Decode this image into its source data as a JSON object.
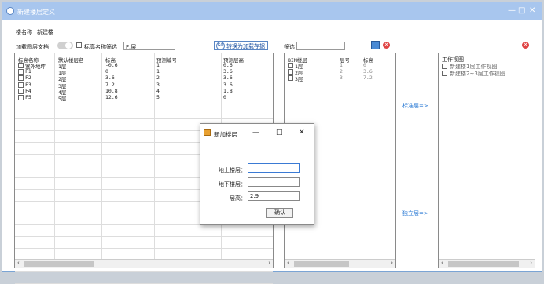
{
  "window": {
    "title": "新建楼层定义",
    "min": "—",
    "max": "□",
    "close": "✕"
  },
  "top": {
    "name_label": "楼名称",
    "name_value": "新建楼",
    "load_label": "加载图层文档",
    "filter_name_label": "标高名称筛选",
    "filter_name_value": "F,层",
    "convert_btn": "转换为加载存据",
    "filter_label": "筛选",
    "filter_value": ""
  },
  "left_table": {
    "headers": [
      "标高名称",
      "默认楼层名",
      "标高",
      "预测编号",
      "预测层高"
    ],
    "rows": [
      [
        "室外地坪",
        "1层",
        "-0.6",
        "1",
        "0.6"
      ],
      [
        "F1",
        "1层",
        "0",
        "1",
        "3.6"
      ],
      [
        "F2",
        "2层",
        "3.6",
        "2",
        "3.6"
      ],
      [
        "F3",
        "3层",
        "7.2",
        "3",
        "3.6"
      ],
      [
        "F4",
        "4层",
        "10.8",
        "4",
        "1.8"
      ],
      [
        "F5",
        "5层",
        "12.6",
        "5",
        "0"
      ]
    ]
  },
  "mid_table": {
    "headers": [
      "BIM楼层",
      "层号",
      "标高"
    ],
    "rows": [
      [
        "1层",
        "1",
        "0"
      ],
      [
        "2层",
        "2",
        "3.6"
      ],
      [
        "3层",
        "3",
        "7.2"
      ]
    ]
  },
  "links": {
    "standard": "标准层=>",
    "standalone": "独立层=>"
  },
  "right_panel": {
    "title": "工作视图",
    "items": [
      "新建楼1层工作视图",
      "新建楼2~3层工作视图"
    ]
  },
  "dialog": {
    "title": "新加楼层",
    "min": "—",
    "max": "□",
    "close": "✕",
    "above_label": "地上楼层：",
    "above_value": "",
    "below_label": "地下楼层：",
    "below_value": "",
    "height_label": "层高：",
    "height_value": "2.9",
    "confirm": "确认"
  },
  "colors": {
    "accent": "#5a86c4",
    "titlebar": "#a8c6ee",
    "link": "#2a7ad4",
    "danger": "#e04444"
  }
}
